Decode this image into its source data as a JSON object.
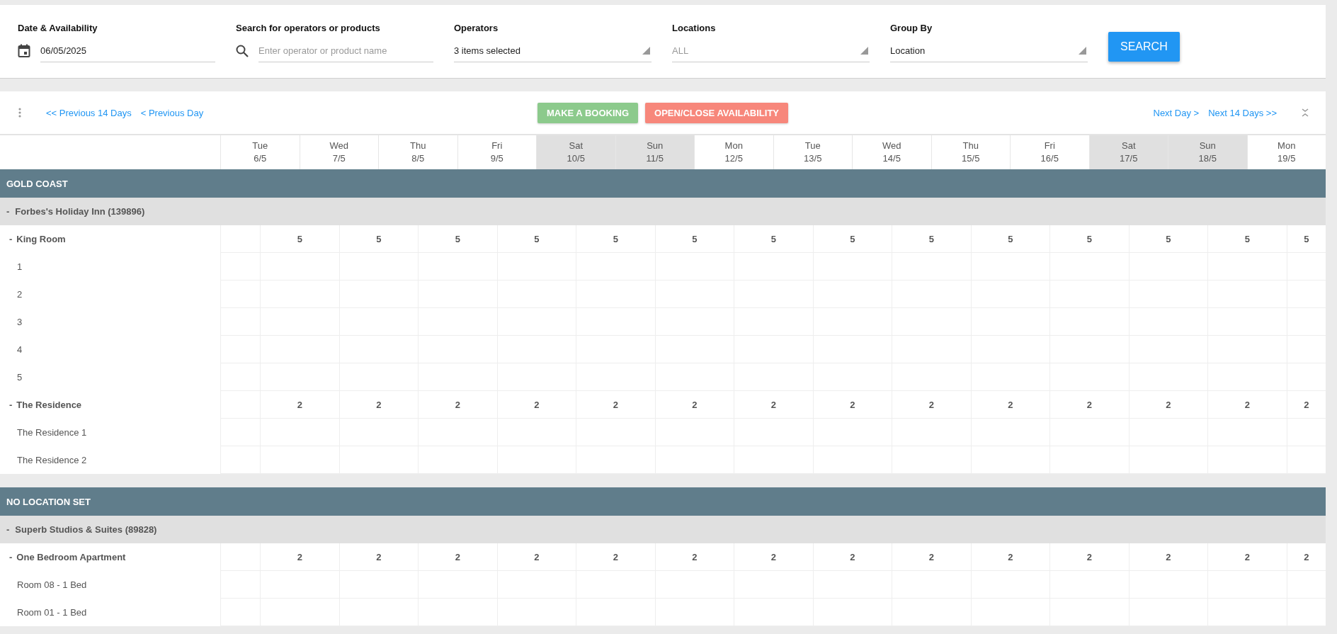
{
  "filters": [
    {
      "kind": "date",
      "label": "Date & Availability",
      "value": "06/05/2025"
    },
    {
      "kind": "search",
      "label": "Search for operators or products",
      "placeholder": "Enter operator or product name"
    },
    {
      "kind": "select",
      "label": "Operators",
      "value": "3 items selected",
      "muted": false
    },
    {
      "kind": "select",
      "label": "Locations",
      "value": "ALL",
      "muted": true
    },
    {
      "kind": "select",
      "label": "Group By",
      "value": "Location",
      "muted": false
    }
  ],
  "search_button": "SEARCH",
  "toolbar": {
    "prev_links": [
      "<< Previous 14 Days",
      "< Previous Day"
    ],
    "actions": [
      {
        "label": "MAKE A BOOKING",
        "color": "#8cca8c"
      },
      {
        "label": "OPEN/CLOSE AVAILABILITY",
        "color": "#f7877b"
      }
    ],
    "next_links": [
      "Next Day >",
      "Next 14 Days >>"
    ]
  },
  "days": [
    {
      "weekday": "Tue",
      "date": "6/5",
      "weekend": false
    },
    {
      "weekday": "Wed",
      "date": "7/5",
      "weekend": false
    },
    {
      "weekday": "Thu",
      "date": "8/5",
      "weekend": false
    },
    {
      "weekday": "Fri",
      "date": "9/5",
      "weekend": false
    },
    {
      "weekday": "Sat",
      "date": "10/5",
      "weekend": true
    },
    {
      "weekday": "Sun",
      "date": "11/5",
      "weekend": true
    },
    {
      "weekday": "Mon",
      "date": "12/5",
      "weekend": false
    },
    {
      "weekday": "Tue",
      "date": "13/5",
      "weekend": false
    },
    {
      "weekday": "Wed",
      "date": "14/5",
      "weekend": false
    },
    {
      "weekday": "Thu",
      "date": "15/5",
      "weekend": false
    },
    {
      "weekday": "Fri",
      "date": "16/5",
      "weekend": false
    },
    {
      "weekday": "Sat",
      "date": "17/5",
      "weekend": true
    },
    {
      "weekday": "Sun",
      "date": "18/5",
      "weekend": true
    },
    {
      "weekday": "Mon",
      "date": "19/5",
      "weekend": false
    }
  ],
  "locations": [
    {
      "name": "GOLD COAST",
      "operators": [
        {
          "toggle": "-",
          "name": "Forbes's Holiday Inn (139896)",
          "products": [
            {
              "toggle": "-",
              "name": "King Room",
              "values": [
                "5",
                "5",
                "5",
                "5",
                "5",
                "5",
                "5",
                "5",
                "5",
                "5",
                "5",
                "5",
                "5",
                "5"
              ],
              "units": [
                "1",
                "2",
                "3",
                "4",
                "5"
              ]
            },
            {
              "toggle": "-",
              "name": "The Residence",
              "values": [
                "2",
                "2",
                "2",
                "2",
                "2",
                "2",
                "2",
                "2",
                "2",
                "2",
                "2",
                "2",
                "2",
                "2"
              ],
              "units": [
                "The Residence 1",
                "The Residence 2"
              ]
            }
          ]
        }
      ]
    },
    {
      "name": "NO LOCATION SET",
      "operators": [
        {
          "toggle": "-",
          "name": "Superb Studios & Suites (89828)",
          "products": [
            {
              "toggle": "-",
              "name": "One Bedroom Apartment",
              "values": [
                "2",
                "2",
                "2",
                "2",
                "2",
                "2",
                "2",
                "2",
                "2",
                "2",
                "2",
                "2",
                "2",
                "2"
              ],
              "units": [
                "Room 08 - 1 Bed",
                "Room 01 - 1 Bed"
              ]
            }
          ]
        }
      ]
    }
  ]
}
